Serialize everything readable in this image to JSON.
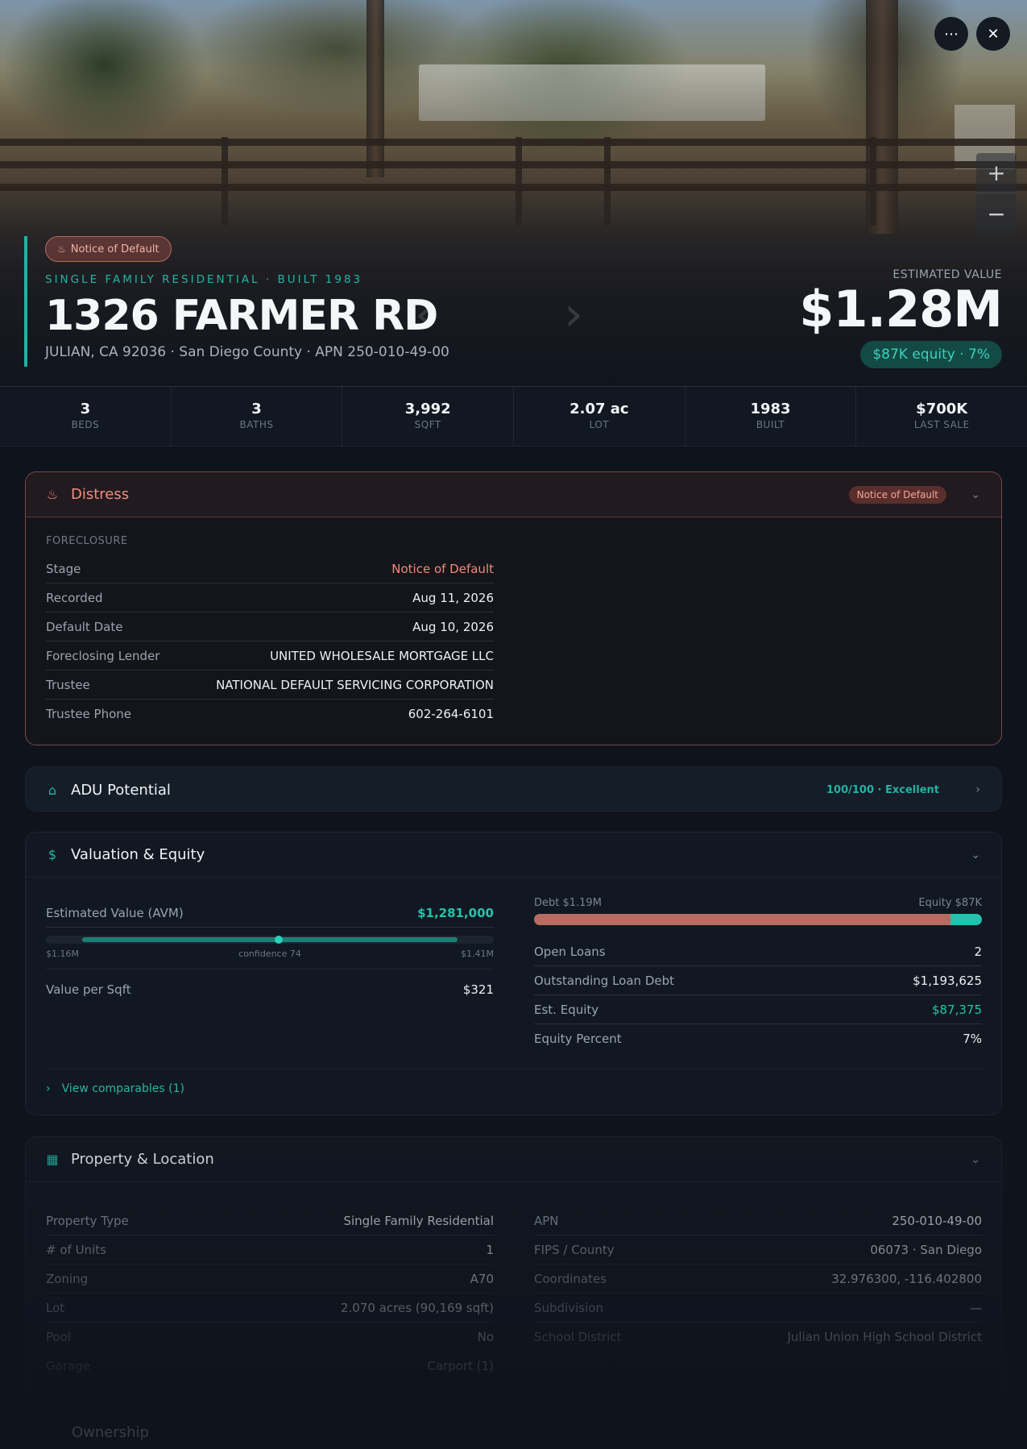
{
  "hero": {
    "badge": "Notice of Default",
    "subtype": "SINGLE FAMILY RESIDENTIAL · BUILT 1983",
    "address": "1326 FARMER RD",
    "location": "JULIAN, CA 92036 · San Diego County · APN 250-010-49-00",
    "estimated_label": "ESTIMATED VALUE",
    "estimated_value": "$1.28M",
    "equity_pill": "$87K equity · 7%"
  },
  "stats": [
    {
      "value": "3",
      "label": "BEDS"
    },
    {
      "value": "3",
      "label": "BATHS"
    },
    {
      "value": "3,992",
      "label": "SQFT"
    },
    {
      "value": "2.07 ac",
      "label": "LOT"
    },
    {
      "value": "1983",
      "label": "BUILT"
    },
    {
      "value": "$700K",
      "label": "LAST SALE"
    }
  ],
  "distress": {
    "title": "Distress",
    "badge": "Notice of Default",
    "section": "FORECLOSURE",
    "rows": [
      {
        "k": "Stage",
        "v": "Notice of Default"
      },
      {
        "k": "Recorded",
        "v": "Aug 11, 2026"
      },
      {
        "k": "Default Date",
        "v": "Aug 10, 2026"
      },
      {
        "k": "Foreclosing Lender",
        "v": "UNITED WHOLESALE MORTGAGE LLC"
      },
      {
        "k": "Trustee",
        "v": "NATIONAL DEFAULT SERVICING CORPORATION"
      },
      {
        "k": "Trustee Phone",
        "v": "602-264-6101"
      }
    ]
  },
  "adu": {
    "title": "ADU Potential",
    "score": "100/100 · Excellent"
  },
  "valuation": {
    "title": "Valuation & Equity",
    "avm_label": "Estimated Value (AVM)",
    "avm_value": "$1,281,000",
    "range_low": "$1.16M",
    "confidence": "confidence 74",
    "range_high": "$1.41M",
    "confidence_level": 0.52,
    "sqft_label": "Value per Sqft",
    "sqft_value": "$321",
    "debt_label": "Debt $1.19M",
    "equity_label": "Equity $87K",
    "debt_fraction": 0.93,
    "rows": [
      {
        "k": "Open Loans",
        "v": "2"
      },
      {
        "k": "Outstanding Loan Debt",
        "v": "$1,193,625"
      },
      {
        "k": "Est. Equity",
        "v": "$87,375"
      },
      {
        "k": "Equity Percent",
        "v": "7%"
      }
    ],
    "comparables": "View comparables (1)"
  },
  "property": {
    "title": "Property & Location",
    "left": [
      {
        "k": "Property Type",
        "v": "Single Family Residential"
      },
      {
        "k": "# of Units",
        "v": "1"
      },
      {
        "k": "Zoning",
        "v": "A70"
      },
      {
        "k": "Lot",
        "v": "2.070 acres (90,169 sqft)"
      },
      {
        "k": "Pool",
        "v": "No"
      },
      {
        "k": "Garage",
        "v": "Carport (1)"
      }
    ],
    "right": [
      {
        "k": "APN",
        "v": "250-010-49-00"
      },
      {
        "k": "FIPS / County",
        "v": "06073 · San Diego"
      },
      {
        "k": "Coordinates",
        "v": "32.976300, -116.402800"
      },
      {
        "k": "Subdivision",
        "v": "—"
      },
      {
        "k": "School District",
        "v": "Julian Union High School District"
      }
    ]
  },
  "ownership": {
    "title": "Ownership"
  },
  "colors": {
    "accent": "#22b5a3",
    "distress": "#f08d7d",
    "background": "#0e131c"
  }
}
